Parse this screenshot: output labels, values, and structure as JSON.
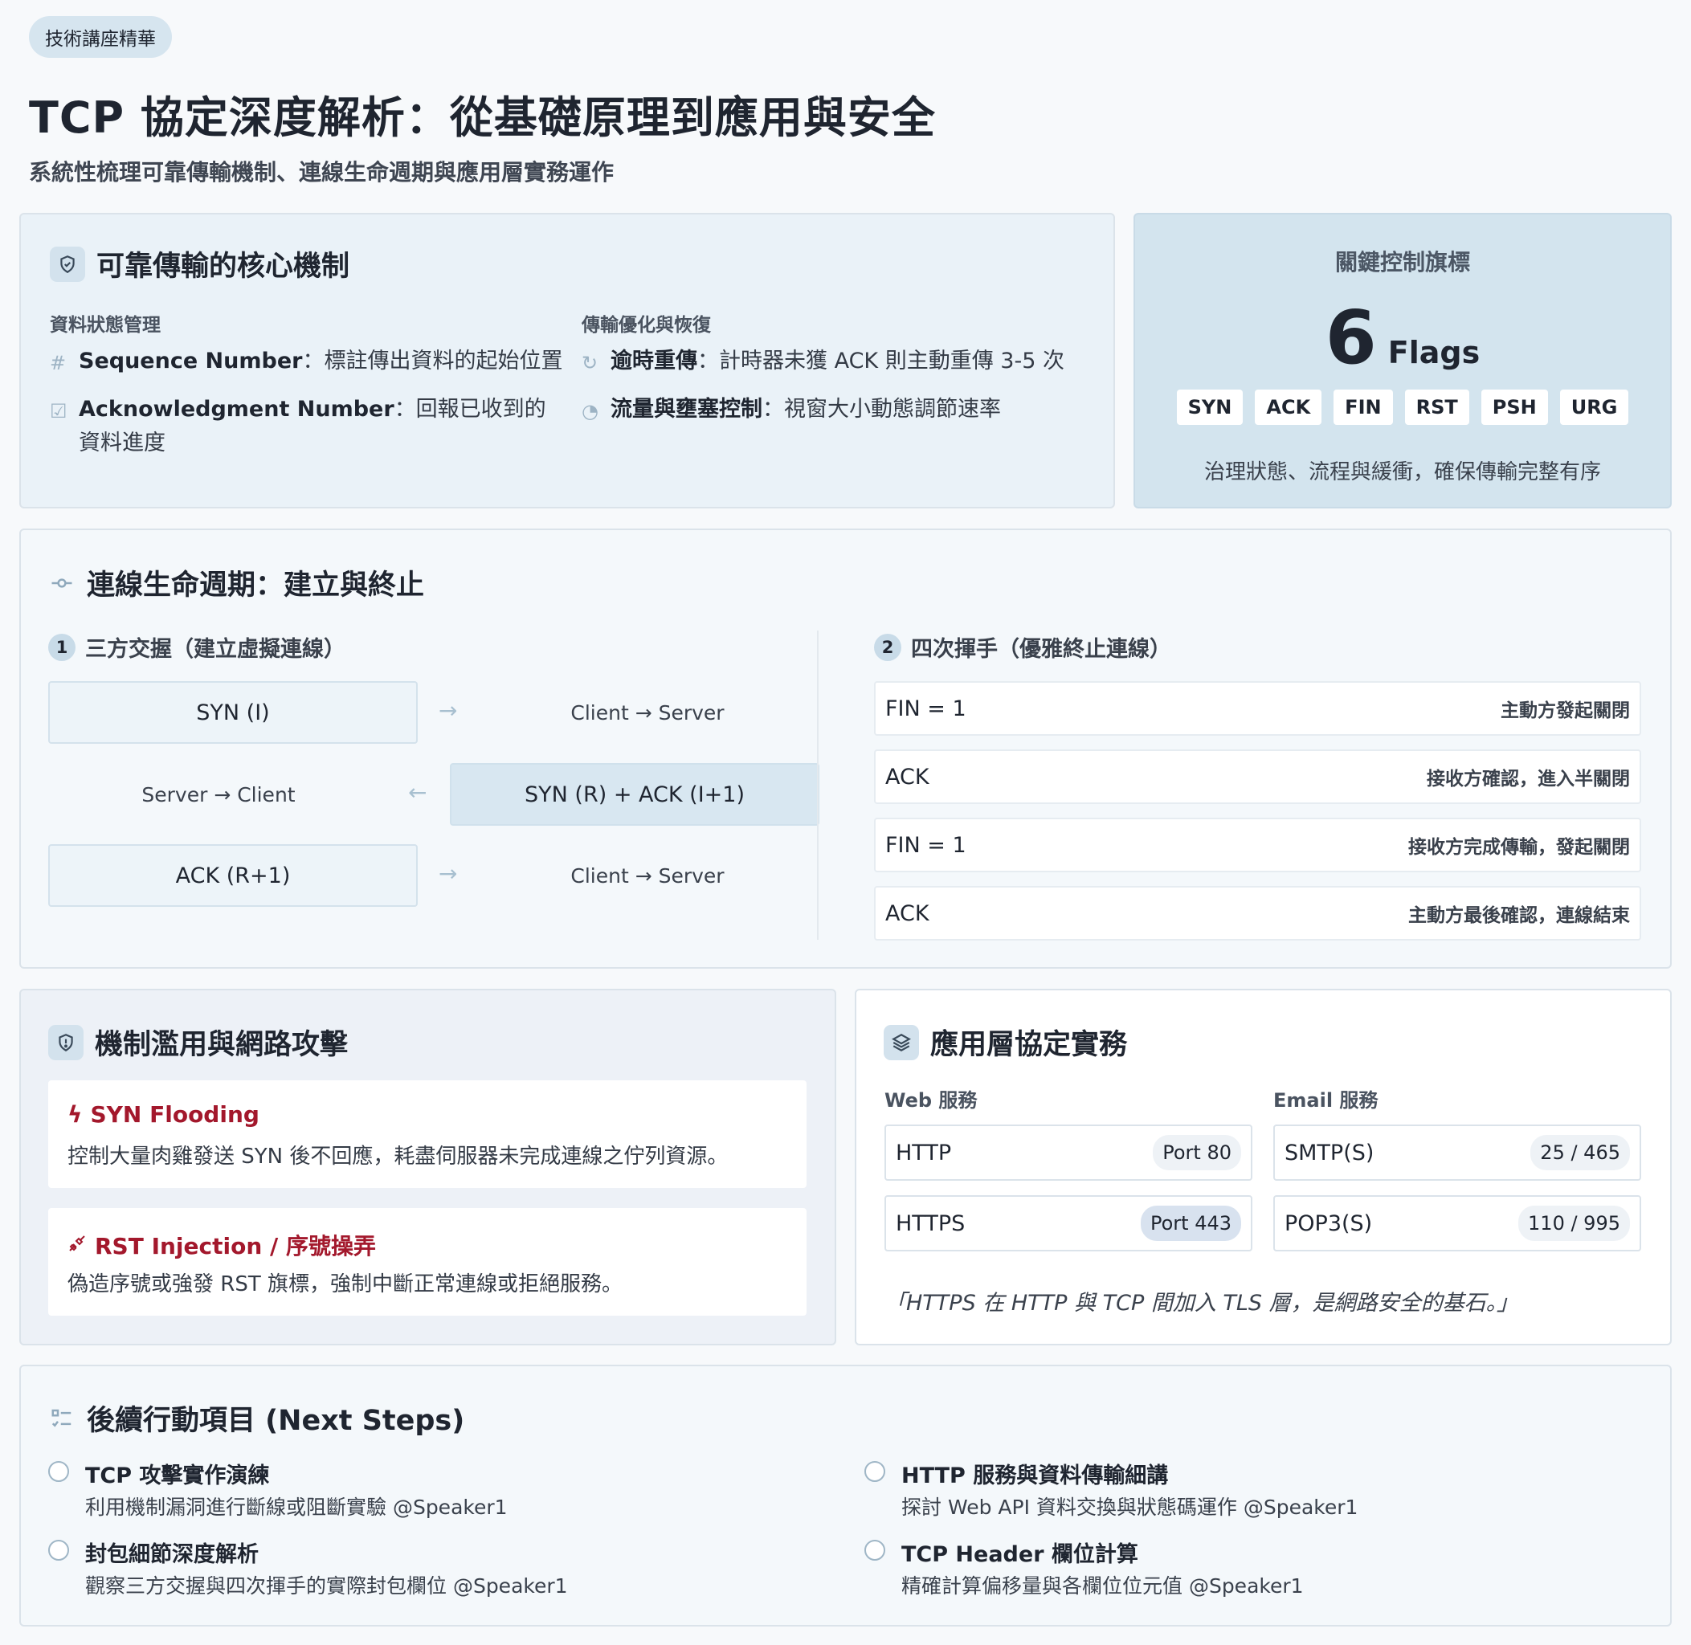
{
  "header": {
    "tag": "技術講座精華",
    "title": "TCP 協定深度解析：從基礎原理到應用與安全",
    "subtitle": "系統性梳理可靠傳輸機制、連線生命週期與應用層實務運作"
  },
  "core": {
    "title": "可靠傳輸的核心機制",
    "col1": {
      "label": "資料狀態管理",
      "items": [
        {
          "bold": "Sequence Number",
          "text": "：標註傳出資料的起始位置"
        },
        {
          "bold": "Acknowledgment Number",
          "text": "：回報已收到的資料進度"
        }
      ]
    },
    "col2": {
      "label": "傳輸優化與恢復",
      "items": [
        {
          "bold": "逾時重傳",
          "text": "：計時器未獲 ACK 則主動重傳 3-5 次"
        },
        {
          "bold": "流量與壅塞控制",
          "text": "：視窗大小動態調節速率"
        }
      ]
    }
  },
  "flags": {
    "label": "關鍵控制旗標",
    "count": "6",
    "unit": "Flags",
    "items": [
      "SYN",
      "ACK",
      "FIN",
      "RST",
      "PSH",
      "URG"
    ],
    "desc": "治理狀態、流程與緩衝，確保傳輸完整有序"
  },
  "lifecycle": {
    "title": "連線生命週期：建立與終止",
    "handshake": {
      "num": "1",
      "title": "三方交握（建立虛擬連線）",
      "steps": [
        {
          "packet": "SYN (I)",
          "dir": "Client → Server"
        },
        {
          "packet": "SYN (R) + ACK (I+1)",
          "dir": "Server → Client"
        },
        {
          "packet": "ACK (R+1)",
          "dir": "Client → Server"
        }
      ]
    },
    "teardown": {
      "num": "2",
      "title": "四次揮手（優雅終止連線）",
      "steps": [
        {
          "k": "FIN = 1",
          "v": "主動方發起關閉"
        },
        {
          "k": "ACK",
          "v": "接收方確認，進入半關閉"
        },
        {
          "k": "FIN = 1",
          "v": "接收方完成傳輸，發起關閉"
        },
        {
          "k": "ACK",
          "v": "主動方最後確認，連線結束"
        }
      ]
    }
  },
  "attacks": {
    "title": "機制濫用與網路攻擊",
    "items": [
      {
        "title": "SYN Flooding",
        "desc": "控制大量肉雞發送 SYN 後不回應，耗盡伺服器未完成連線之佇列資源。"
      },
      {
        "title": "RST Injection / 序號操弄",
        "desc": "偽造序號或強發 RST 旗標，強制中斷正常連線或拒絕服務。"
      }
    ]
  },
  "app": {
    "title": "應用層協定實務",
    "web": {
      "label": "Web 服務",
      "items": [
        {
          "name": "HTTP",
          "port": "Port 80"
        },
        {
          "name": "HTTPS",
          "port": "Port 443"
        }
      ]
    },
    "email": {
      "label": "Email 服務",
      "items": [
        {
          "name": "SMTP(S)",
          "port": "25 / 465"
        },
        {
          "name": "POP3(S)",
          "port": "110 / 995"
        }
      ]
    },
    "quote": "「HTTPS 在 HTTP 與 TCP 間加入 TLS 層，是網路安全的基石。」"
  },
  "next": {
    "title": "後續行動項目 (Next Steps)",
    "items": [
      {
        "title": "TCP 攻擊實作演練",
        "desc": "利用機制漏洞進行斷線或阻斷實驗 @Speaker1"
      },
      {
        "title": "HTTP 服務與資料傳輸細講",
        "desc": "探討 Web API 資料交換與狀態碼運作 @Speaker1"
      },
      {
        "title": "封包細節深度解析",
        "desc": "觀察三方交握與四次揮手的實際封包欄位 @Speaker1"
      },
      {
        "title": "TCP Header 欄位計算",
        "desc": "精確計算偏移量與各欄位位元值 @Speaker1"
      }
    ]
  }
}
